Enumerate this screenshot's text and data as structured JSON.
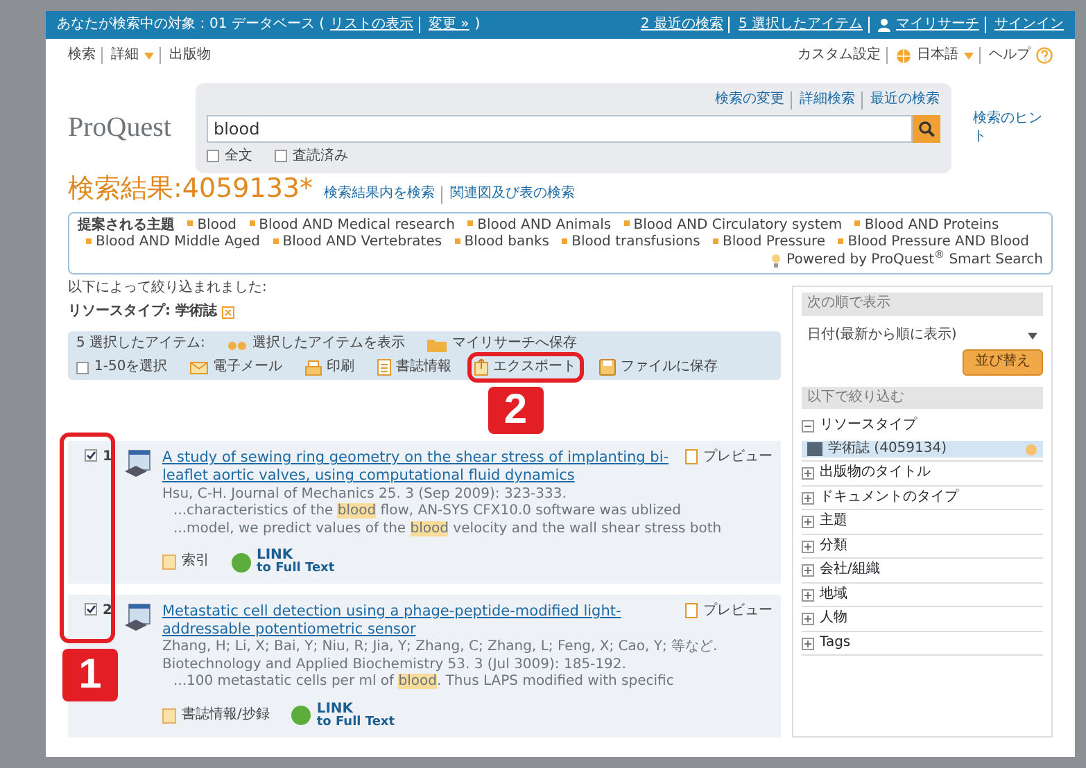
{
  "top_bar": {
    "scope_label": "あなたが検索中の対象：01 データベース (",
    "scope_links": [
      "リストの表示",
      "変更 »"
    ],
    "scope_close": ")",
    "links": [
      {
        "kind": "text",
        "label": "2 最近の検索"
      },
      {
        "kind": "text",
        "label": "5 選択したアイテム"
      },
      {
        "kind": "user",
        "label": "マイリサーチ"
      },
      {
        "kind": "text",
        "label": "サインイン"
      }
    ]
  },
  "nav": {
    "left": [
      {
        "label": "検索",
        "caret": false
      },
      {
        "label": "詳細",
        "caret": true
      },
      {
        "label": "出版物",
        "caret": false
      }
    ],
    "right": [
      {
        "kind": "text",
        "label": "カスタム設定"
      },
      {
        "kind": "language",
        "label": "日本語"
      },
      {
        "kind": "help",
        "label": "ヘルプ"
      }
    ]
  },
  "search": {
    "logo": "ProQuest",
    "links": [
      "検索の変更",
      "詳細検索",
      "最近の検索"
    ],
    "value": "blood",
    "options": [
      {
        "label": "全文",
        "checked": false
      },
      {
        "label": "査読済み",
        "checked": false
      }
    ],
    "tips": "検索のヒント"
  },
  "results_heading": {
    "title": "検索結果:4059133*",
    "links": [
      "検索結果内を検索",
      "関連図及び表の検索"
    ]
  },
  "suggestions": {
    "label": "提案される主題",
    "topics": [
      "Blood",
      "Blood AND Medical research",
      "Blood AND Animals",
      "Blood AND Circulatory system",
      "Blood AND Proteins",
      "Blood AND Middle Aged",
      "Blood AND Vertebrates",
      "Blood banks",
      "Blood transfusions",
      "Blood Pressure",
      "Blood Pressure AND Blood"
    ],
    "powered_by": "Powered by ProQuest$^{®}$ Smart Search"
  },
  "filters": {
    "heading": "以下によって絞り込まれました:",
    "items": [
      "リソースタイプ: 学術誌"
    ]
  },
  "toolbar": {
    "count_label": "5 選択したアイテム:",
    "row_1": [
      {
        "kind": "view",
        "label": "選択したアイテムを表示"
      },
      {
        "kind": "folder",
        "label": "マイリサーチへ保存"
      }
    ],
    "select_all": {
      "label": "1-50を選択",
      "checked": false
    },
    "row_2": [
      {
        "kind": "email",
        "label": "電子メール"
      },
      {
        "kind": "print",
        "label": "印刷"
      },
      {
        "kind": "cite",
        "label": "書誌情報"
      },
      {
        "kind": "export",
        "label": "エクスポート"
      },
      {
        "kind": "save",
        "label": "ファイルに保存"
      }
    ]
  },
  "results": [
    {
      "number": "1",
      "checked": true,
      "title": "A study of sewing ring geometry on the shear stress of implanting bi-leaflet aortic valves, using computational fluid dynamics",
      "citation": "Hsu, C-H. Journal of Mechanics 25. 3  (Sep 2009): 323-333.",
      "snippets": [
        [
          {
            "text": "...characteristics of the ",
            "hl": false
          },
          {
            "text": "blood",
            "hl": true
          },
          {
            "text": " flow, AN-SYS CFX10.0 software was ublized",
            "hl": false
          }
        ],
        [
          {
            "text": "...model, we predict values of the ",
            "hl": false
          },
          {
            "text": "blood",
            "hl": true
          },
          {
            "text": " velocity and the wall shear stress both",
            "hl": false
          }
        ]
      ],
      "link": "索引",
      "preview": "プレビュー",
      "fulltext": [
        "LINK",
        "to Full Text"
      ]
    },
    {
      "number": "2",
      "checked": true,
      "title": "Metastatic cell detection using a phage-peptide-modified light-addressable potentiometric sensor",
      "citation": "Zhang, H; Li, X; Bai, Y; Niu, R; Jia, Y; Zhang, C; Zhang, L; Feng, X; Cao, Y; 等など. Biotechnology and Applied Biochemistry 53. 3  (Jul 3009): 185-192.",
      "snippets": [
        [
          {
            "text": "...100 metastatic cells per ml of ",
            "hl": false
          },
          {
            "text": "blood",
            "hl": true
          },
          {
            "text": ". Thus LAPS modified with specific",
            "hl": false
          }
        ]
      ],
      "link": "書誌情報/抄録",
      "preview": "プレビュー",
      "fulltext": [
        "LINK",
        "to Full Text"
      ]
    }
  ],
  "sidebar": {
    "sort_heading": "次の順で表示",
    "sort_value": "日付(最新から順に表示)",
    "sort_button": "並び替え",
    "narrow_heading": "以下で絞り込む",
    "facets": [
      {
        "label": "リソースタイプ",
        "expanded": true,
        "children": [
          {
            "label": "学術誌 (4059134)",
            "selected": true
          }
        ]
      },
      {
        "label": "出版物のタイトル",
        "expanded": false
      },
      {
        "label": "ドキュメントのタイプ",
        "expanded": false
      },
      {
        "label": "主題",
        "expanded": false
      },
      {
        "label": "分類",
        "expanded": false
      },
      {
        "label": "会社/組織",
        "expanded": false
      },
      {
        "label": "地域",
        "expanded": false
      },
      {
        "label": "人物",
        "expanded": false
      },
      {
        "label": "Tags",
        "expanded": false
      }
    ]
  },
  "annotations": [
    {
      "label": "1"
    },
    {
      "label": "2"
    }
  ]
}
